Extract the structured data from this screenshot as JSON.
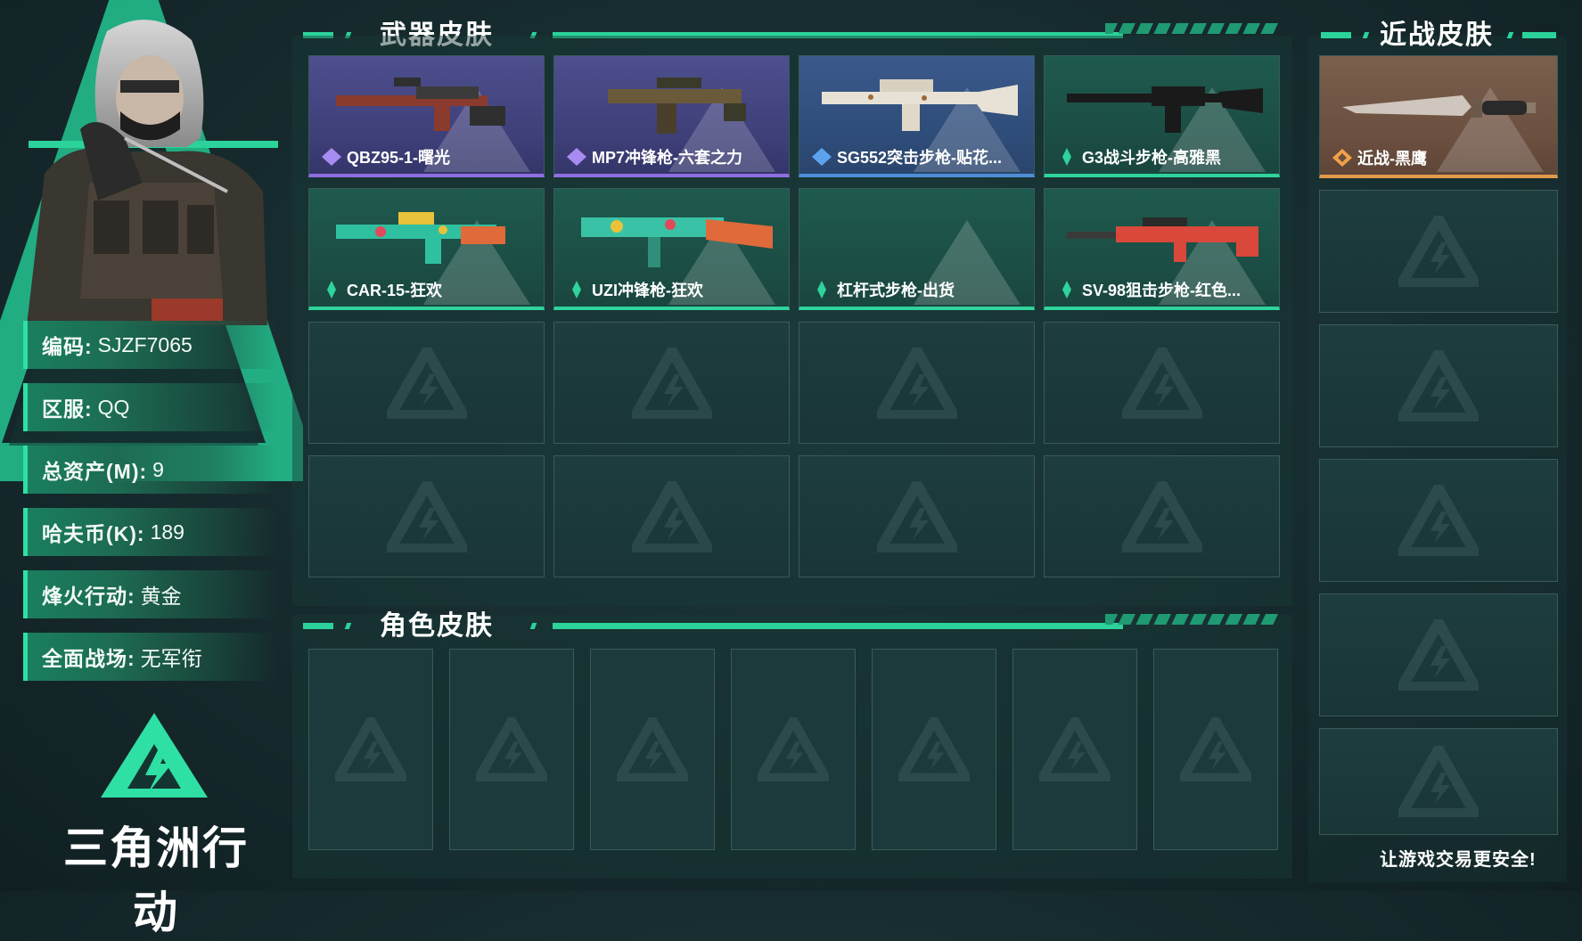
{
  "profile": {
    "rows": [
      {
        "key": "编码:",
        "value": "SJZF7065"
      },
      {
        "key": "区服:",
        "value": "QQ"
      },
      {
        "key": "总资产(M):",
        "value": "9"
      },
      {
        "key": "哈夫币(K):",
        "value": "189"
      },
      {
        "key": "烽火行动:",
        "value": "黄金"
      },
      {
        "key": "全面战场:",
        "value": "无军衔"
      }
    ]
  },
  "brand": {
    "name": "三角洲行动",
    "slogan": "让游戏交易更安全!"
  },
  "sections": {
    "weapon_title": "武器皮肤",
    "character_title": "角色皮肤",
    "melee_title": "近战皮肤"
  },
  "weapons": [
    {
      "label": "QBZ95-1-曙光",
      "rarity": "purple",
      "gun_color": "#8a3b2e"
    },
    {
      "label": "MP7冲锋枪-六套之力",
      "rarity": "purple",
      "gun_color": "#6b5a3a"
    },
    {
      "label": "SG552突击步枪-贴花...",
      "rarity": "blue",
      "gun_color": "#e8e2d6"
    },
    {
      "label": "G3战斗步枪-高雅黑",
      "rarity": "green",
      "gun_color": "#1a1a1a"
    },
    {
      "label": "CAR-15-狂欢",
      "rarity": "green",
      "gun_color": "#2fc0a0"
    },
    {
      "label": "UZI冲锋枪-狂欢",
      "rarity": "green",
      "gun_color": "#3ac2a6"
    },
    {
      "label": "杠杆式步枪-出货",
      "rarity": "green",
      "gun_color": ""
    },
    {
      "label": "SV-98狙击步枪-红色...",
      "rarity": "green",
      "gun_color": "#d9483a"
    }
  ],
  "melee": [
    {
      "label": "近战-黑鹰",
      "rarity": "orange"
    }
  ],
  "colors": {
    "accent": "#2bd39a",
    "purple": "#8f6ee0",
    "blue": "#4e8ed6",
    "green": "#2fd39b",
    "orange": "#e39a4a"
  }
}
